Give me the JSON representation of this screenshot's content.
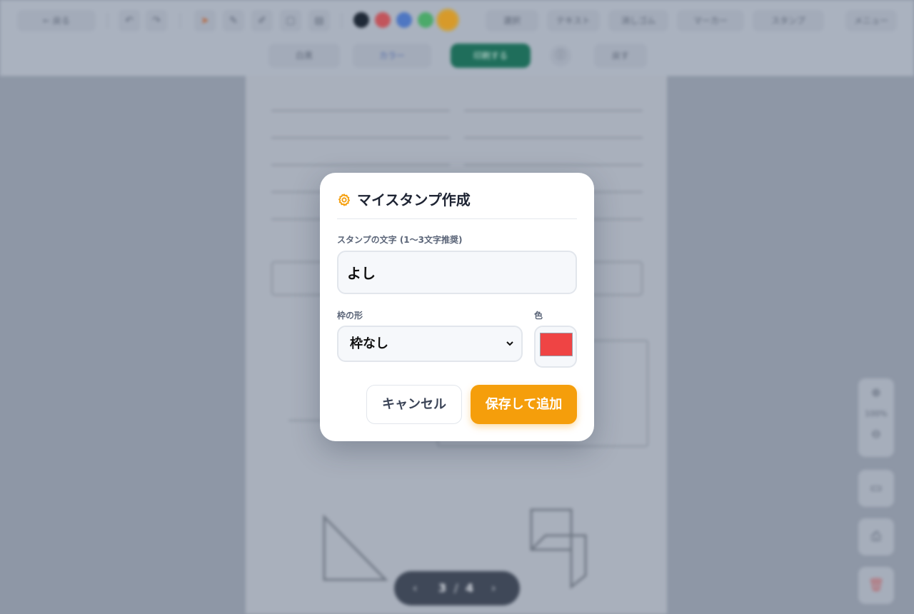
{
  "modal": {
    "title": "マイスタンプ作成",
    "title_icon": "gear-icon",
    "text_label": "スタンプの文字 (1〜3文字推奨)",
    "text_value": "よし",
    "frame_label": "枠の形",
    "frame_value": "枠なし",
    "color_label": "色",
    "color_value": "#ef4444",
    "cancel_label": "キャンセル",
    "save_label": "保存して追加",
    "accent_color": "#f59e0b"
  },
  "toolbar": {
    "back_label": "← 戻る",
    "colors": [
      "#1f2937",
      "#ef4444",
      "#3b82f6",
      "#22c55e",
      "#f59e0b"
    ],
    "tool_icons": [
      "cursor-icon",
      "pen-icon",
      "highlighter-icon",
      "eraser-icon",
      "shape-icon"
    ],
    "mode_labels": [
      "選択",
      "テキスト",
      "消しゴム",
      "マーカー",
      "スタンプ"
    ],
    "menu_label": "メニュー",
    "row2_left_label": "白黒",
    "row2_mid_label": "カラー",
    "row2_green_label": "印刷する",
    "row2_right_label": "戻す"
  },
  "pager": {
    "current": "3",
    "separator": "/",
    "total": "4"
  },
  "zoom": {
    "level": "100%"
  }
}
